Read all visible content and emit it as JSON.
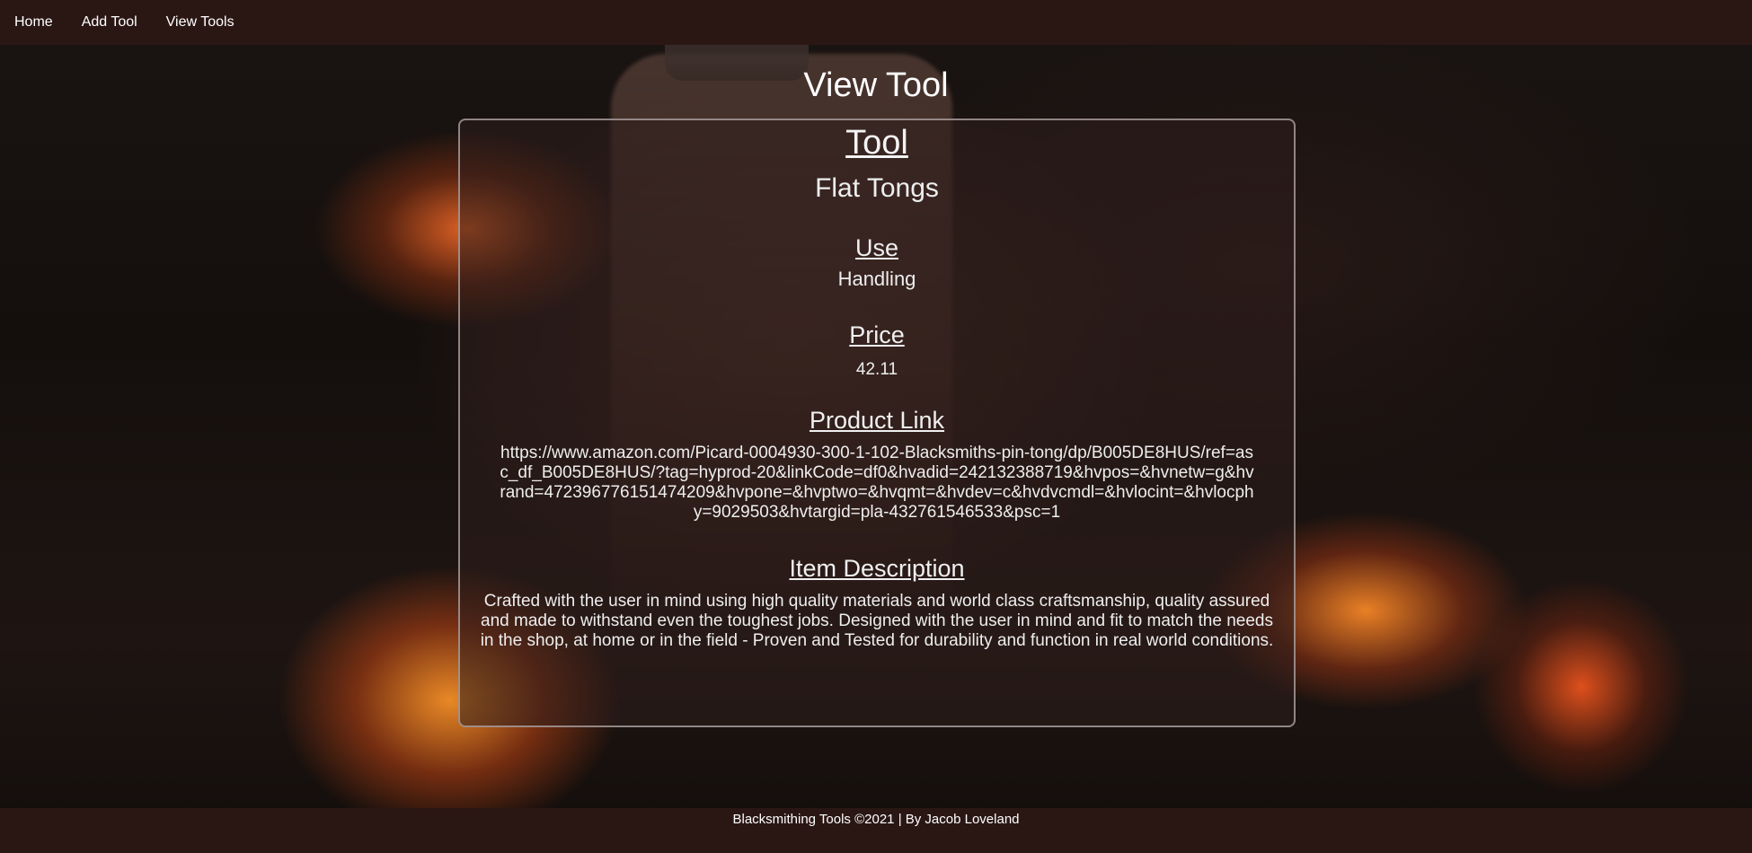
{
  "nav": {
    "items": [
      {
        "label": "Home"
      },
      {
        "label": "Add Tool"
      },
      {
        "label": "View Tools"
      }
    ]
  },
  "page": {
    "title": "View Tool"
  },
  "tool": {
    "heading": "Tool",
    "name": "Flat Tongs",
    "use_heading": "Use",
    "use": "Handling",
    "price_heading": "Price",
    "price": "42.11",
    "link_heading": "Product Link",
    "link": "https://www.amazon.com/Picard-0004930-300-1-102-Blacksmiths-pin-tong/dp/B005DE8HUS/ref=asc_df_B005DE8HUS/?tag=hyprod-20&linkCode=df0&hvadid=242132388719&hvpos=&hvnetw=g&hvrand=4723967761514742​09&hvpone=&hvptwo=&hvqmt=&hvdev=c&hvdvcmdl=&hvlocint=&hvlocphy=9029503&hvtargid=pla-432761546533&psc=1",
    "description_heading": "Item Description",
    "description": "Crafted with the user in mind using high quality materials and world class craftsmanship, quality assured and made to withstand even the toughest jobs. Designed with the user in mind and fit to match the needs in the shop, at home or in the field - Proven and Tested for durability and function in real world conditions."
  },
  "footer": {
    "text": "Blacksmithing Tools ©2021 | By Jacob Loveland"
  }
}
